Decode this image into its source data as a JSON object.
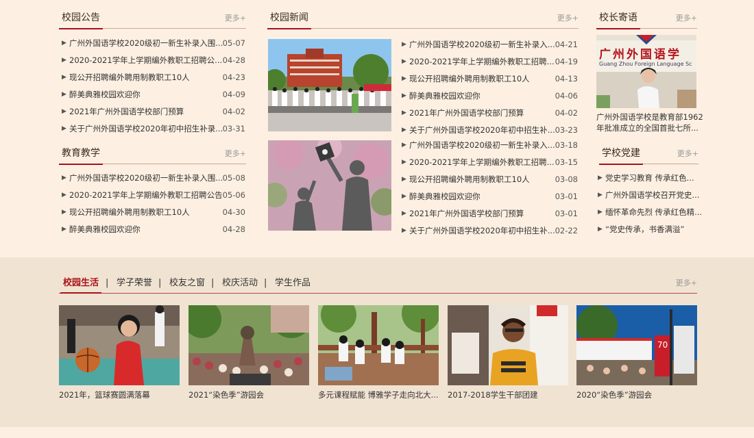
{
  "announcements": {
    "title": "校园公告",
    "more": "更多+",
    "items": [
      {
        "text": "广州外国语学校2020级初一新生补录入围...",
        "date": "05-07"
      },
      {
        "text": "2020-2021学年上学期编外教职工招聘公...",
        "date": "04-28"
      },
      {
        "text": "现公开招聘编外聘用制教职工10人",
        "date": "04-23"
      },
      {
        "text": "醉美典雅校园欢迎你",
        "date": "04-09"
      },
      {
        "text": "2021年广州外国语学校部门预算",
        "date": "04-02"
      },
      {
        "text": "关于广州外国语学校2020年初中招生补录...",
        "date": "03-31"
      }
    ]
  },
  "teaching": {
    "title": "教育教学",
    "more": "更多+",
    "items": [
      {
        "text": "广州外国语学校2020级初一新生补录入围...",
        "date": "05-08"
      },
      {
        "text": "2020-2021学年上学期编外教职工招聘公告",
        "date": "05-06"
      },
      {
        "text": "现公开招聘编外聘用制教职工10人",
        "date": "04-30"
      },
      {
        "text": "醉美典雅校园欢迎你",
        "date": "04-28"
      }
    ]
  },
  "news": {
    "title": "校园新闻",
    "more": "更多+",
    "items_top": [
      {
        "text": "广州外国语学校2020级初一新生补录入...",
        "date": "04-21"
      },
      {
        "text": "2020-2021学年上学期编外教职工招聘...",
        "date": "04-19"
      },
      {
        "text": "现公开招聘编外聘用制教职工10人",
        "date": "04-13"
      },
      {
        "text": "醉美典雅校园欢迎你",
        "date": "04-06"
      },
      {
        "text": "2021年广州外国语学校部门预算",
        "date": "04-02"
      },
      {
        "text": "关于广州外国语学校2020年初中招生补...",
        "date": "03-23"
      }
    ],
    "items_bottom": [
      {
        "text": "广州外国语学校2020级初一新生补录入...",
        "date": "03-18"
      },
      {
        "text": "2020-2021学年上学期编外教职工招聘...",
        "date": "03-15"
      },
      {
        "text": "现公开招聘编外聘用制教职工10人",
        "date": "03-08"
      },
      {
        "text": "醉美典雅校园欢迎你",
        "date": "03-01"
      },
      {
        "text": "2021年广州外国语学校部门预算",
        "date": "03-01"
      },
      {
        "text": "关于广州外国语学校2020年初中招生补...",
        "date": "02-22"
      }
    ]
  },
  "principal": {
    "title": "校长寄语",
    "more": "更多+",
    "banner_cn": "广州外国语学",
    "banner_en": "Guang Zhou Foreign Language Sc",
    "desc_line1": "广州外国语学校是教育部1962",
    "desc_line2": "年批准成立的全国首批七所..."
  },
  "party": {
    "title": "学校党建",
    "more": "更多+",
    "items": [
      {
        "text": "党史学习教育 传承红色..."
      },
      {
        "text": "广州外国语学校召开党史..."
      },
      {
        "text": "缅怀革命先烈 传承红色精..."
      },
      {
        "text": "“党史传承，书香满溢”"
      }
    ]
  },
  "life": {
    "tabs": [
      "校园生活",
      "学子荣誉",
      "校友之窗",
      "校庆活动",
      "学生作品"
    ],
    "separator": "|",
    "more": "更多+",
    "items": [
      {
        "caption": "2021年，篮球赛圆满落幕"
      },
      {
        "caption": "2021“染色季”游园会"
      },
      {
        "caption": "多元课程赋能 博雅学子走向北大..."
      },
      {
        "caption": "2017-2018学生干部团建"
      },
      {
        "caption": "2020“染色季”游园会"
      }
    ]
  },
  "colors": {
    "accent": "#a8101a",
    "background": "#fdf0e2",
    "band": "#f1e3d2"
  }
}
